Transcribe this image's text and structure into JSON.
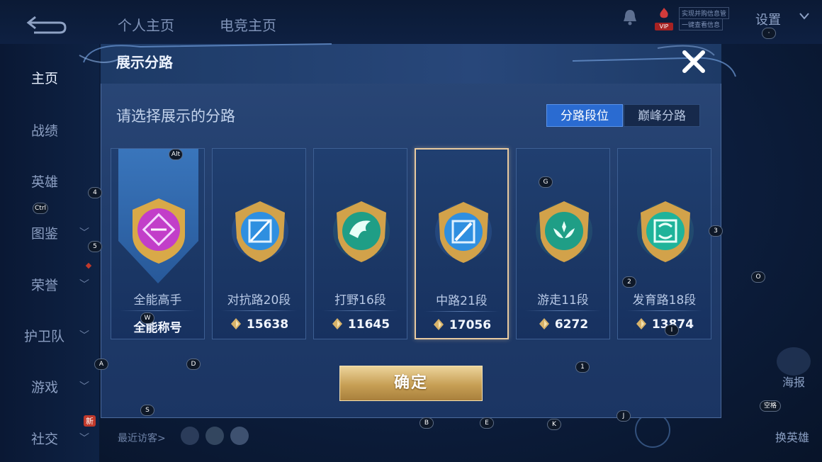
{
  "top_nav": {
    "tab_home": "个人主页",
    "tab_esports": "电竞主页",
    "settings": "设置",
    "vip_badge": "VIP",
    "notice_line1": "实现并购信息管",
    "notice_line2": "一键查看信息"
  },
  "sidebar": {
    "items": [
      "主页",
      "战绩",
      "英雄",
      "图鉴",
      "荣誉",
      "护卫队",
      "游戏",
      "社交"
    ],
    "new_badge": "新"
  },
  "dialog": {
    "title": "展示分路",
    "subtitle": "请选择展示的分路",
    "segments": [
      "分路段位",
      "巅峰分路"
    ],
    "cards": [
      {
        "label": "全能高手",
        "value": "全能称号",
        "emblem": "allround-emblem",
        "color": "#c23ec9"
      },
      {
        "label": "对抗路20段",
        "value": "15638",
        "emblem": "clash-lane-emblem",
        "color": "#2f8fe0"
      },
      {
        "label": "打野16段",
        "value": "11645",
        "emblem": "jungle-emblem",
        "color": "#1f9e86"
      },
      {
        "label": "中路21段",
        "value": "17056",
        "emblem": "mid-lane-emblem",
        "color": "#2f8fe0"
      },
      {
        "label": "游走11段",
        "value": "6272",
        "emblem": "roam-emblem",
        "color": "#1f9e86"
      },
      {
        "label": "发育路18段",
        "value": "13874",
        "emblem": "farm-lane-emblem",
        "color": "#1fb39a"
      }
    ],
    "confirm": "确定"
  },
  "footer": {
    "recent_visitors": "最近访客>"
  },
  "right_buttons": {
    "poster": "海报",
    "change_hero": "换英雄"
  },
  "key_hints": {
    "alt": "Alt",
    "ctrl": "Ctrl",
    "k4": "4",
    "k5": "5",
    "k3": "3",
    "k2": "2",
    "kO": "O",
    "kG": "G",
    "kW": "W",
    "kA": "A",
    "kD": "D",
    "kS": "S",
    "kB": "B",
    "kE": "E",
    "kK": "K",
    "kJ": "J",
    "k1": "1",
    "kI": "I",
    "dot": "·",
    "space": "空格"
  }
}
